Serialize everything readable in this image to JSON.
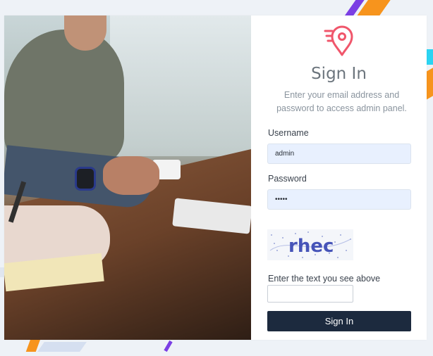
{
  "header": {
    "title": "Sign In",
    "subtitle": "Enter your email address and password to access admin panel."
  },
  "icons": {
    "logo": "map-pin-icon"
  },
  "form": {
    "username_label": "Username",
    "username_value": "admin",
    "password_label": "Password",
    "password_value": "•••••",
    "captcha_text": "rhec",
    "captcha_label": "Enter the text you see above",
    "captcha_value": "",
    "submit_label": "Sign In"
  },
  "colors": {
    "accent": "#f0566b",
    "button": "#1c2a3e",
    "field_bg": "#e8f0fe"
  }
}
